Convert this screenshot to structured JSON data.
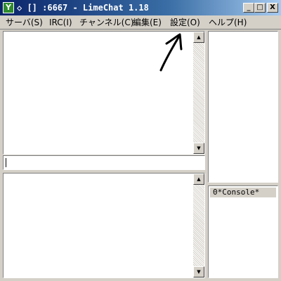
{
  "window": {
    "icon_glyph": "Y",
    "title": "◇ [] :6667 - LimeChat 1.18",
    "buttons": {
      "minimize": "_",
      "maximize": "□",
      "close": "X"
    }
  },
  "menu": [
    {
      "label": "サーバ(S)"
    },
    {
      "label": "IRC(I)"
    },
    {
      "label": "チャンネル(C)"
    },
    {
      "label": "編集(E)"
    },
    {
      "label": "設定(O)"
    },
    {
      "label": "ヘルプ(H)"
    }
  ],
  "input": {
    "value": ""
  },
  "channels": [
    {
      "label": "0*Console*"
    }
  ],
  "icons": {
    "scroll_up": "up-arrow-icon",
    "scroll_down": "down-arrow-icon",
    "annotation": "hand-drawn-arrow"
  },
  "colors": {
    "titlebar_start": "#0a246a",
    "titlebar_end": "#a6caf0",
    "window_bg": "#d4d0c8",
    "panel_bg": "#ffffff",
    "channel_selected_bg": "#d4d0c8"
  }
}
